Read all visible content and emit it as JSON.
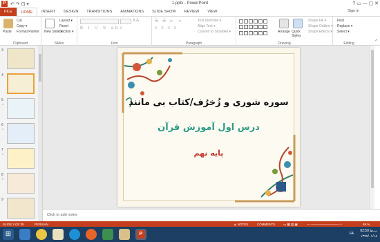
{
  "window": {
    "title": "1.pptx - PowerPoint",
    "app_icon": "P",
    "quick_access": "↶ ↷ ⊡ ▾",
    "controls": "? ▭ — ▢ ✕"
  },
  "tabs": [
    "FILE",
    "HOME",
    "INSERT",
    "DESIGN",
    "TRANSITIONS",
    "ANIMATIONS",
    "SLIDE SHOW",
    "REVIEW",
    "VIEW"
  ],
  "active_tab": "HOME",
  "account": "Sign in",
  "ribbon": {
    "clipboard": {
      "label": "Clipboard",
      "paste": "Paste",
      "cut": "Cut",
      "copy": "Copy ▾",
      "format_painter": "Format Painter"
    },
    "slides": {
      "label": "Slides",
      "new_slide": "New Slide ▾",
      "layout": "Layout ▾",
      "reset": "Reset",
      "section": "Section ▾"
    },
    "font": {
      "label": "Font"
    },
    "paragraph": {
      "label": "Paragraph",
      "text_direction": "Text Direction ▾",
      "align_text": "Align Text ▾",
      "smartart": "Convert to SmartArt ▾"
    },
    "drawing": {
      "label": "Drawing",
      "arrange": "Arrange",
      "quick_styles": "Quick Styles",
      "shape_fill": "Shape Fill ▾",
      "shape_outline": "Shape Outline ▾",
      "shape_effects": "Shape Effects ▾"
    },
    "editing": {
      "label": "Editing",
      "find": "Find",
      "replace": "Replace ▾",
      "select": "Select ▾"
    }
  },
  "thumbnails": [
    {
      "num": "3",
      "star": ""
    },
    {
      "num": "4",
      "star": ""
    },
    {
      "num": "5",
      "star": "*"
    },
    {
      "num": "6",
      "star": "*"
    },
    {
      "num": "7",
      "star": "*"
    },
    {
      "num": "8",
      "star": "*"
    },
    {
      "num": "9",
      "star": ""
    }
  ],
  "slide": {
    "title": "سوره شوری و زُخرُف/کتاب بی مانند",
    "subtitle": "درس اول آموزش قرآن",
    "grade": "پایه نهم"
  },
  "notes_placeholder": "Click to add notes",
  "status": {
    "slide_count": "SLIDE 2 OF 35",
    "language": "PERSIAN",
    "notes": "▲ NOTES",
    "comments": "COMMENTS",
    "zoom": "69 %"
  },
  "taskbar": {
    "language": "FA",
    "time": "02:59 ب.ظ",
    "date": "۱۳۹۷/۰۱/۱۸"
  },
  "colors": {
    "accent": "#c43e1c",
    "title_text": "#111111",
    "subtitle_text": "#2f9a87",
    "grade_text": "#c0392b",
    "taskbar": "#1c3f63"
  }
}
